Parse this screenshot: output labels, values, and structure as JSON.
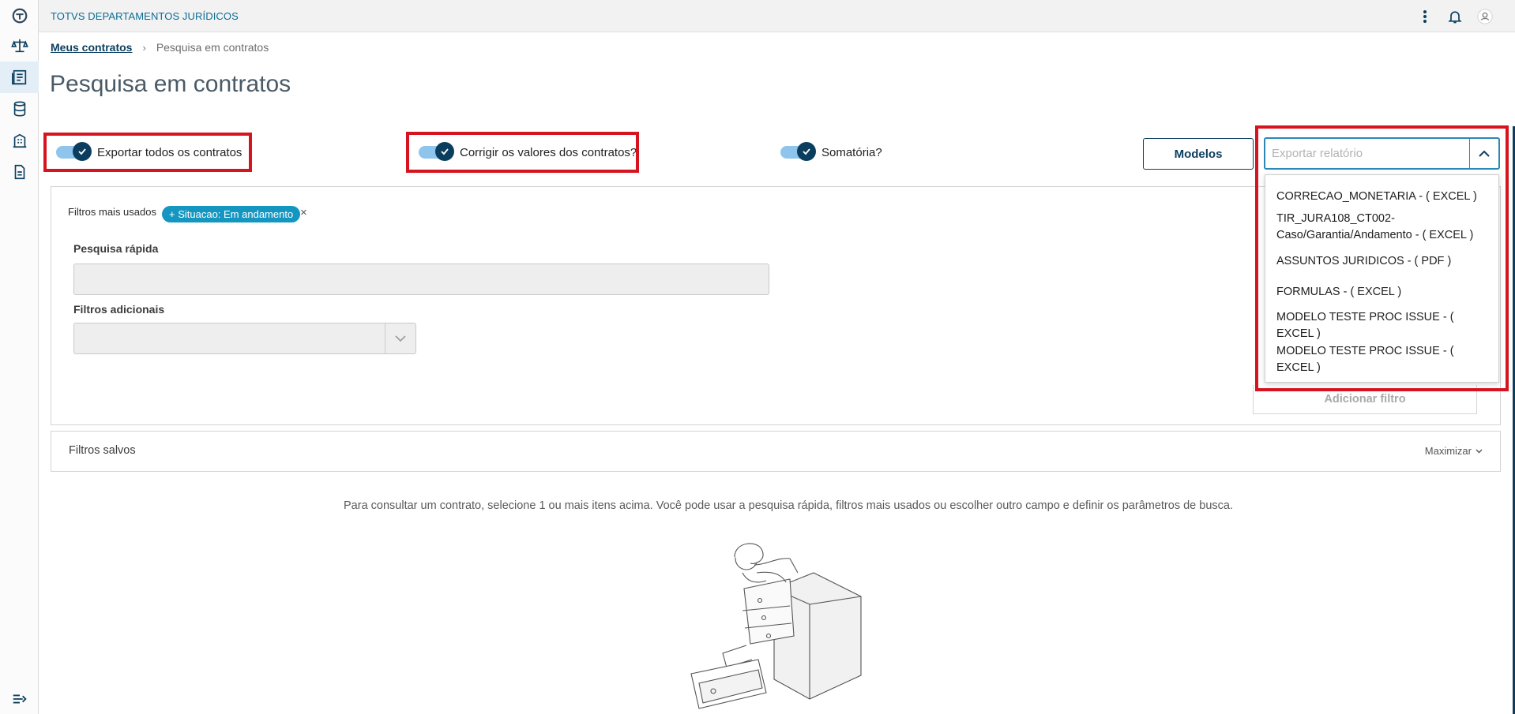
{
  "app": {
    "title": "TOTVS DEPARTAMENTOS JURÍDICOS"
  },
  "sidebar": {
    "items": [
      {
        "icon": "app-logo-icon"
      },
      {
        "icon": "scale-icon"
      },
      {
        "icon": "contracts-icon",
        "active": true
      },
      {
        "icon": "database-icon"
      },
      {
        "icon": "building-icon"
      },
      {
        "icon": "document-icon"
      }
    ],
    "collapse_icon": "collapse-menu-icon"
  },
  "topbar": {
    "icons": [
      "more-vertical-icon",
      "bell-icon",
      "user-avatar-icon"
    ]
  },
  "breadcrumb": {
    "link": "Meus contratos",
    "current": "Pesquisa em contratos"
  },
  "page_title": "Pesquisa em contratos",
  "toggles": {
    "export_all": {
      "label": "Exportar todos os contratos",
      "on": true
    },
    "fix_values": {
      "label": "Corrigir os valores dos contratos?",
      "on": true
    },
    "sum": {
      "label": "Somatória?",
      "on": true
    }
  },
  "buttons": {
    "modelos": "Modelos",
    "add_filter": "Adicionar filtro"
  },
  "export_combo": {
    "placeholder": "Exportar relatório",
    "options": [
      "CORRECAO_MONETARIA - ( EXCEL )",
      "TIR_JURA108_CT002-Caso/Garantia/Andamento - ( EXCEL )",
      "ASSUNTOS JURIDICOS - ( PDF )",
      "FORMULAS - ( EXCEL )",
      "MODELO TESTE PROC ISSUE - ( EXCEL )",
      "MODELO TESTE PROC ISSUE - ( EXCEL )"
    ]
  },
  "filters": {
    "most_used_label": "Filtros mais usados",
    "chip": "+ Situacao: Em andamento",
    "chip_close": "×",
    "quick_search_label": "Pesquisa rápida",
    "additional_label": "Filtros adicionais"
  },
  "saved_filters": {
    "title": "Filtros salvos",
    "maximize": "Maximizar"
  },
  "hint": "Para consultar um contrato, selecione 1 ou mais itens acima. Você pode usar a pesquisa rápida, filtros mais usados ou escolher outro campo e definir os parâmetros de busca.",
  "colors": {
    "primary": "#0b3e5e",
    "accent": "#1596c1",
    "highlight": "#d5141f",
    "toggle_track": "#8fc4ec"
  }
}
